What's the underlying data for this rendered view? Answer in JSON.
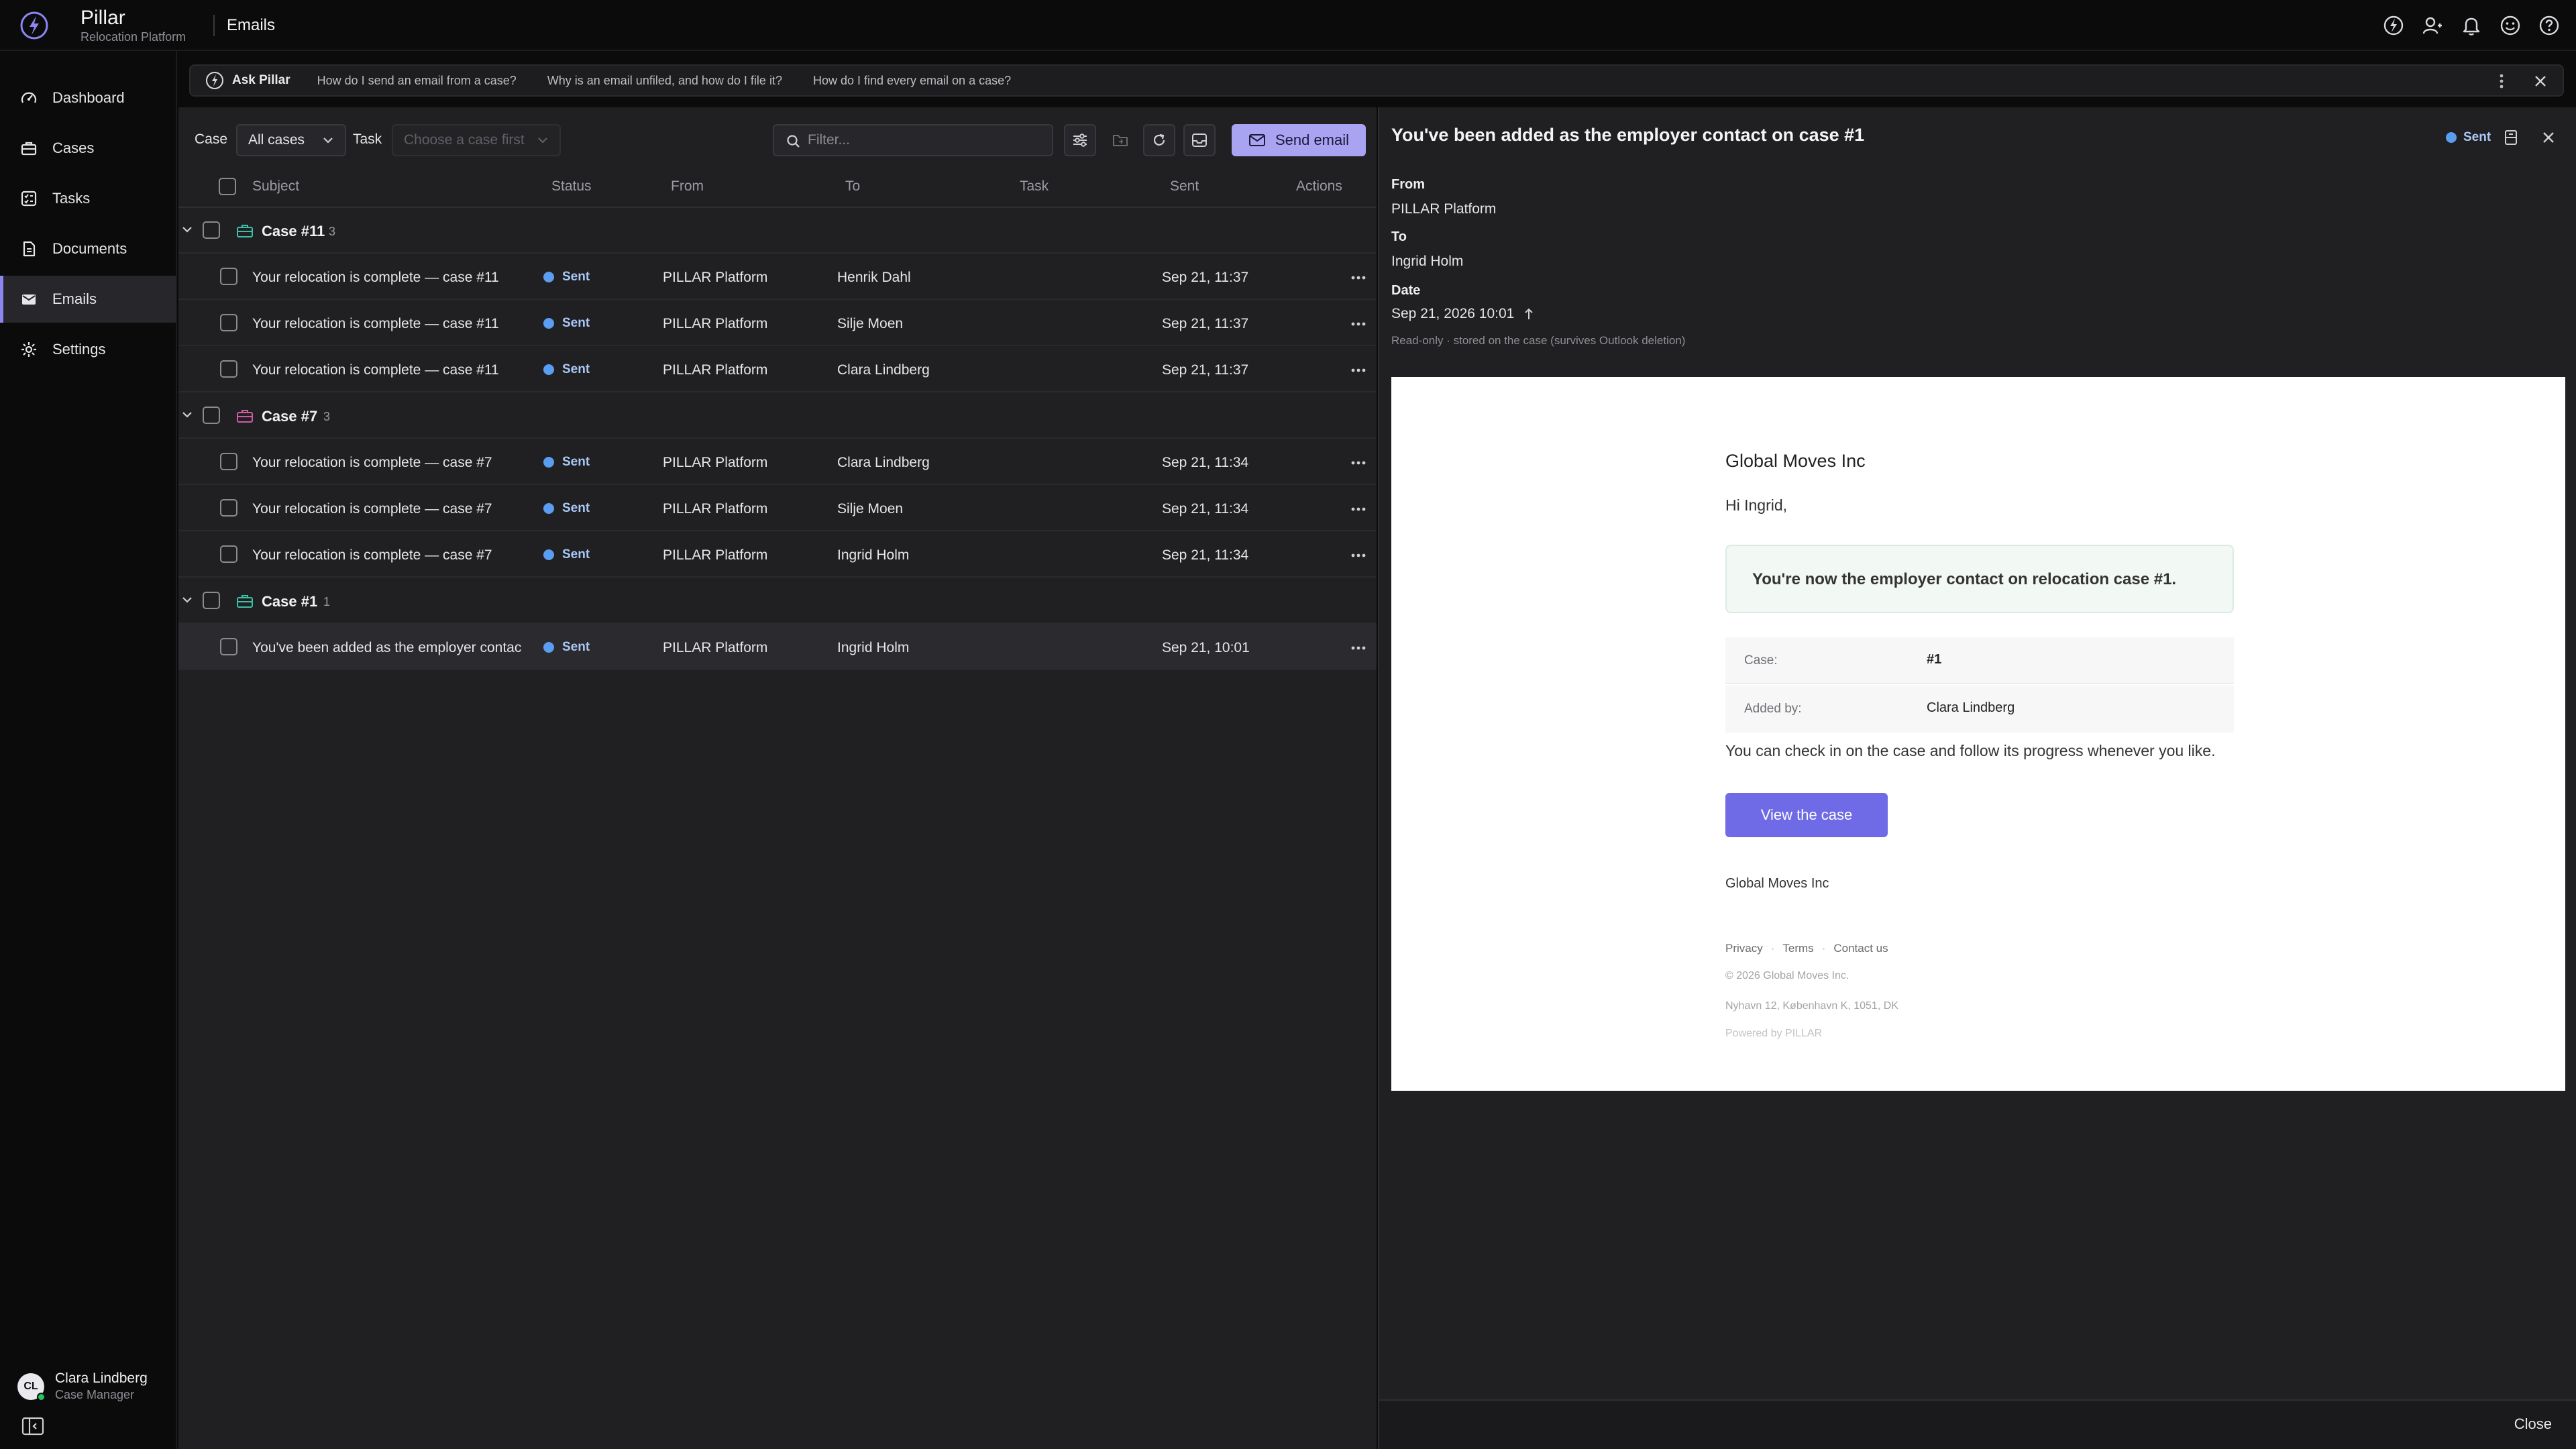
{
  "app": {
    "name": "Pillar",
    "subtitle": "Relocation Platform",
    "page_title": "Emails"
  },
  "top_icons": [
    "pillar-logo-icon",
    "user-switch-icon",
    "bell-icon",
    "smiley-icon",
    "help-icon"
  ],
  "sidebar": {
    "items": [
      {
        "label": "Dashboard",
        "icon": "dashboard-icon"
      },
      {
        "label": "Cases",
        "icon": "briefcase-icon"
      },
      {
        "label": "Tasks",
        "icon": "checklist-icon"
      },
      {
        "label": "Documents",
        "icon": "document-icon"
      },
      {
        "label": "Emails",
        "icon": "mail-icon",
        "active": true
      },
      {
        "label": "Settings",
        "icon": "gear-icon"
      }
    ],
    "user": {
      "initials": "CL",
      "name": "Clara Lindberg",
      "role": "Case Manager"
    }
  },
  "ask": {
    "title": "Ask Pillar",
    "questions": [
      "How do I send an email from a case?",
      "Why is an email unfiled, and how do I file it?",
      "How do I find every email on a case?"
    ]
  },
  "toolbar": {
    "case_label": "Case",
    "case_value": "All cases",
    "task_label": "Task",
    "task_placeholder": "Choose a case first",
    "filter_placeholder": "Filter...",
    "send_label": "Send email"
  },
  "columns": [
    "Subject",
    "Status",
    "From",
    "To",
    "Task",
    "Sent",
    "Actions"
  ],
  "groups": [
    {
      "name": "Case #11",
      "count": "3",
      "rows": [
        {
          "subject": "Your relocation is complete — case #11",
          "status": "Sent",
          "from": "PILLAR Platform",
          "to": "Henrik Dahl",
          "task": "",
          "sent": "Sep 21, 11:37"
        },
        {
          "subject": "Your relocation is complete — case #11",
          "status": "Sent",
          "from": "PILLAR Platform",
          "to": "Silje Moen",
          "task": "",
          "sent": "Sep 21, 11:37"
        },
        {
          "subject": "Your relocation is complete — case #11",
          "status": "Sent",
          "from": "PILLAR Platform",
          "to": "Clara Lindberg",
          "task": "",
          "sent": "Sep 21, 11:37"
        }
      ]
    },
    {
      "name": "Case #7",
      "count": "3",
      "rows": [
        {
          "subject": "Your relocation is complete — case #7",
          "status": "Sent",
          "from": "PILLAR Platform",
          "to": "Clara Lindberg",
          "task": "",
          "sent": "Sep 21, 11:34"
        },
        {
          "subject": "Your relocation is complete — case #7",
          "status": "Sent",
          "from": "PILLAR Platform",
          "to": "Silje Moen",
          "task": "",
          "sent": "Sep 21, 11:34"
        },
        {
          "subject": "Your relocation is complete — case #7",
          "status": "Sent",
          "from": "PILLAR Platform",
          "to": "Ingrid Holm",
          "task": "",
          "sent": "Sep 21, 11:34"
        }
      ]
    },
    {
      "name": "Case #1",
      "count": "1",
      "rows": [
        {
          "subject": "You've been added as the employer contac",
          "status": "Sent",
          "from": "PILLAR Platform",
          "to": "Ingrid Holm",
          "task": "",
          "sent": "Sep 21, 10:01",
          "selected": true
        }
      ]
    }
  ],
  "detail": {
    "title": "You've been added as the employer contact on case #1",
    "status": "Sent",
    "from_label": "From",
    "from_value": "PILLAR Platform",
    "to_label": "To",
    "to_value": "Ingrid Holm",
    "date_label": "Date",
    "date_value": "Sep 21, 2026 10:01",
    "readonly_note": "Read-only · stored on the case (survives Outlook deletion)",
    "close_label": "Close"
  },
  "email": {
    "company": "Global Moves Inc",
    "greeting": "Hi Ingrid,",
    "callout": "You're now the employer contact on relocation case #1.",
    "table": [
      {
        "key": "Case:",
        "value": "#1"
      },
      {
        "key": "Added by:",
        "value": "Clara Lindberg"
      }
    ],
    "body": "You can check in on the case and follow its progress whenever you like.",
    "button": "View the case",
    "signature": "Global Moves Inc",
    "links": [
      "Privacy",
      "Terms",
      "Contact us"
    ],
    "link_sep": "·",
    "copyright": "© 2026 Global Moves Inc.",
    "address": "Nyhavn 12, København K, 1051, DK",
    "powered": "Powered by PILLAR"
  },
  "colors": {
    "accent": "#8b86f0",
    "send_button": "#a8a4f2",
    "status_dot": "#5b9df0",
    "email_button": "#6f6ae6"
  }
}
